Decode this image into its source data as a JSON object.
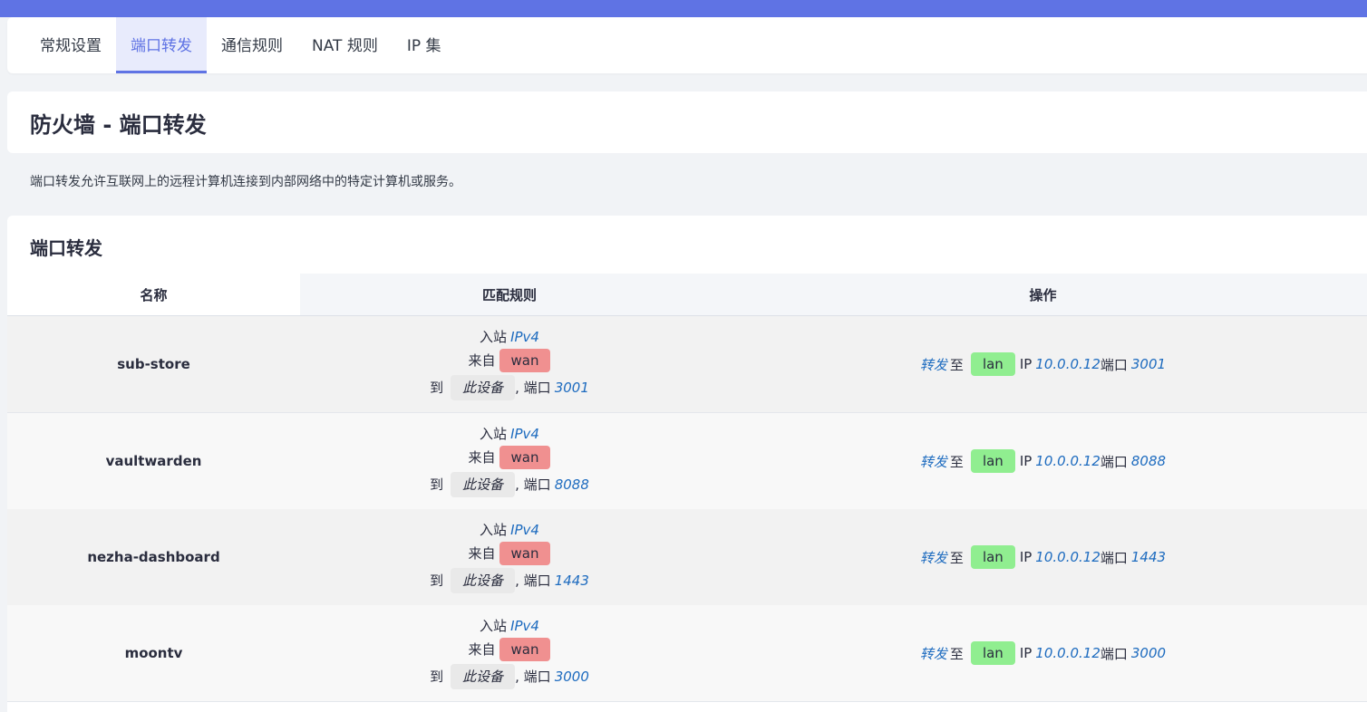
{
  "tabs": [
    {
      "label": "常规设置",
      "active": false
    },
    {
      "label": "端口转发",
      "active": true
    },
    {
      "label": "通信规则",
      "active": false
    },
    {
      "label": "NAT 规则",
      "active": false
    },
    {
      "label": "IP 集",
      "active": false
    }
  ],
  "page_title": "防火墙 - 端口转发",
  "description": "端口转发允许互联网上的远程计算机连接到内部网络中的特定计算机或服务。",
  "section_title": "端口转发",
  "table": {
    "headers": {
      "name": "名称",
      "match": "匹配规则",
      "action": "操作"
    },
    "rows": [
      {
        "name": "sub-store",
        "match": {
          "inbound": "入站",
          "family": "IPv4",
          "from": "来自",
          "src_zone": "wan",
          "to": "到",
          "device": "此设备",
          "port_label": ", 端口",
          "port": "3001"
        },
        "action": {
          "forward": "转发",
          "to": "至",
          "zone": "lan",
          "ip_label": "IP",
          "ip": "10.0.0.12",
          "port_label": "端口",
          "port": "3001"
        }
      },
      {
        "name": "vaultwarden",
        "match": {
          "inbound": "入站",
          "family": "IPv4",
          "from": "来自",
          "src_zone": "wan",
          "to": "到",
          "device": "此设备",
          "port_label": ", 端口",
          "port": "8088"
        },
        "action": {
          "forward": "转发",
          "to": "至",
          "zone": "lan",
          "ip_label": "IP",
          "ip": "10.0.0.12",
          "port_label": "端口",
          "port": "8088"
        }
      },
      {
        "name": "nezha-dashboard",
        "match": {
          "inbound": "入站",
          "family": "IPv4",
          "from": "来自",
          "src_zone": "wan",
          "to": "到",
          "device": "此设备",
          "port_label": ", 端口",
          "port": "1443"
        },
        "action": {
          "forward": "转发",
          "to": "至",
          "zone": "lan",
          "ip_label": "IP",
          "ip": "10.0.0.12",
          "port_label": "端口",
          "port": "1443"
        }
      },
      {
        "name": "moontv",
        "match": {
          "inbound": "入站",
          "family": "IPv4",
          "from": "来自",
          "src_zone": "wan",
          "to": "到",
          "device": "此设备",
          "port_label": ", 端口",
          "port": "3000"
        },
        "action": {
          "forward": "转发",
          "to": "至",
          "zone": "lan",
          "ip_label": "IP",
          "ip": "10.0.0.12",
          "port_label": "端口",
          "port": "3000"
        }
      }
    ]
  },
  "colors": {
    "accent": "#5f73e4",
    "wan_zone": "#f09090",
    "lan_zone": "#90ee90",
    "link": "#1d6bbf"
  }
}
